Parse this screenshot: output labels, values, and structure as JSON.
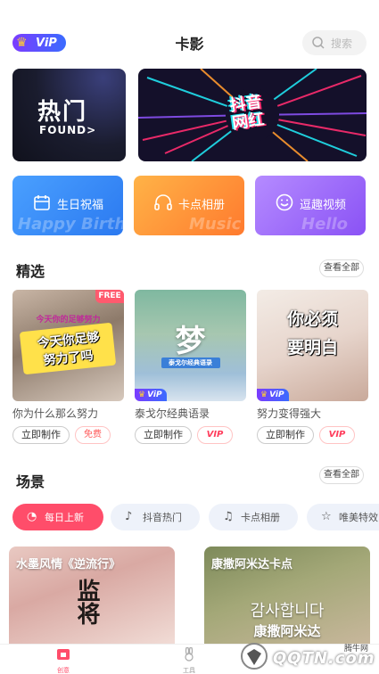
{
  "header": {
    "vip_label": "ViP",
    "title": "卡影",
    "search_placeholder": "搜索"
  },
  "banners": {
    "hot_title": "热门",
    "hot_sub": "FOUND>",
    "tiktok_title_line1": "抖音",
    "tiktok_title_line2": "网红"
  },
  "categories": [
    {
      "label": "生日祝福",
      "ghost": "Happy Birth",
      "icon": "calendar-icon"
    },
    {
      "label": "卡点相册",
      "ghost": "Music",
      "icon": "headphones-icon"
    },
    {
      "label": "逗趣视频",
      "ghost": "Hello",
      "icon": "smile-icon"
    }
  ],
  "featured": {
    "title": "精选",
    "see_all": "查看全部",
    "items": [
      {
        "caption": "你为什么那么努力",
        "make": "立即制作",
        "tag": "免费",
        "corner": "FREE",
        "thumb_text1": "今天你足够",
        "thumb_text2": "努力了吗",
        "thumb_small": "今天你的足够努力"
      },
      {
        "caption": "泰戈尔经典语录",
        "make": "立即制作",
        "tag": "VIP",
        "corner": "ViP",
        "thumb_text1": "梦",
        "thumb_small": "泰戈尔经典语录"
      },
      {
        "caption": "努力变得强大",
        "make": "立即制作",
        "tag": "VIP",
        "corner": "ViP",
        "thumb_text1": "你必须",
        "thumb_text2": "要明白"
      }
    ]
  },
  "scenes": {
    "title": "场景",
    "see_all": "查看全部",
    "tabs": [
      {
        "label": "每日上新",
        "icon": "apple-icon"
      },
      {
        "label": "抖音热门",
        "icon": "tiktok-icon"
      },
      {
        "label": "卡点相册",
        "icon": "music-note-icon"
      },
      {
        "label": "唯美特效",
        "icon": "star-icon"
      }
    ],
    "cards": [
      {
        "title": "水墨风情《逆流行》",
        "overlay": "监将"
      },
      {
        "title": "康撒阿米达卡点",
        "overlay1": "감사합니다",
        "overlay2": "康撒阿米达"
      }
    ]
  },
  "nav": {
    "items": [
      {
        "label": "创意",
        "icon": "creative-icon"
      },
      {
        "label": "工具",
        "icon": "rabbit-icon"
      }
    ]
  },
  "watermark": {
    "text": "QQTN.com",
    "small": "腾牛网"
  },
  "colors": {
    "accent": "#ff4d6a",
    "vip": "#7b3cff",
    "blue": "#2b79f0",
    "orange": "#ff7a2e",
    "purple": "#8a52f5"
  }
}
